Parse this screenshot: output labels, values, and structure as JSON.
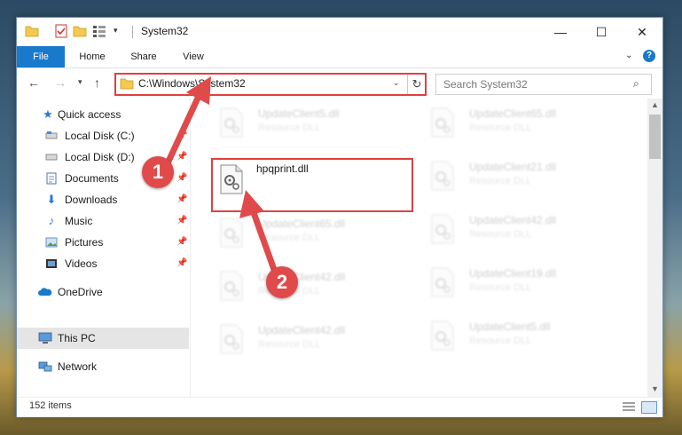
{
  "window": {
    "title": "System32",
    "controls": {
      "minimize": "—",
      "maximize": "☐",
      "close": "✕"
    }
  },
  "ribbon": {
    "tabs": [
      {
        "label": "File"
      },
      {
        "label": "Home"
      },
      {
        "label": "Share"
      },
      {
        "label": "View"
      }
    ],
    "help": "?"
  },
  "address": {
    "path": "C:\\Windows\\System32",
    "search_placeholder": "Search System32"
  },
  "nav": {
    "items": [
      {
        "label": "Quick access",
        "icon": "star-icon",
        "pinned": false
      },
      {
        "label": "Local Disk (C:)",
        "icon": "drive-icon",
        "pinned": true
      },
      {
        "label": "Local Disk (D:)",
        "icon": "drive-icon",
        "pinned": true
      },
      {
        "label": "Documents",
        "icon": "documents-icon",
        "pinned": true
      },
      {
        "label": "Downloads",
        "icon": "download-icon",
        "pinned": true
      },
      {
        "label": "Music",
        "icon": "music-icon",
        "pinned": true
      },
      {
        "label": "Pictures",
        "icon": "pictures-icon",
        "pinned": true
      },
      {
        "label": "Videos",
        "icon": "videos-icon",
        "pinned": true
      },
      {
        "label": "OneDrive",
        "icon": "cloud-icon",
        "pinned": false
      },
      {
        "label": "This PC",
        "icon": "computer-icon",
        "pinned": false,
        "selected": true
      },
      {
        "label": "Network",
        "icon": "network-icon",
        "pinned": false
      }
    ]
  },
  "files": {
    "highlighted": {
      "name": "hpqprint.dll"
    },
    "col1": [
      {
        "name": "UpdateClient5.dll",
        "type": "Resource DLL"
      },
      {
        "name": "UpdateClient65.dll",
        "type": "Resource DLL"
      },
      {
        "name": "UpdateClient42.dll",
        "type": "Resource DLL"
      },
      {
        "name": "UpdateClient42.dll",
        "type": "Resource DLL"
      }
    ],
    "col2": [
      {
        "name": "UpdateClient65.dll",
        "type": "Resource DLL"
      },
      {
        "name": "UpdateClient21.dll",
        "type": "Resource DLL"
      },
      {
        "name": "UpdateClient42.dll",
        "type": "Resource DLL"
      },
      {
        "name": "UpdateClient19.dll",
        "type": "Resource DLL"
      },
      {
        "name": "UpdateClient5.dll",
        "type": "Resource DLL"
      }
    ]
  },
  "status": {
    "count": "152 items"
  },
  "callouts": {
    "one": "1",
    "two": "2"
  },
  "colors": {
    "accent": "#1979ca",
    "highlight": "#e04040",
    "callout": "#e04a4a"
  }
}
